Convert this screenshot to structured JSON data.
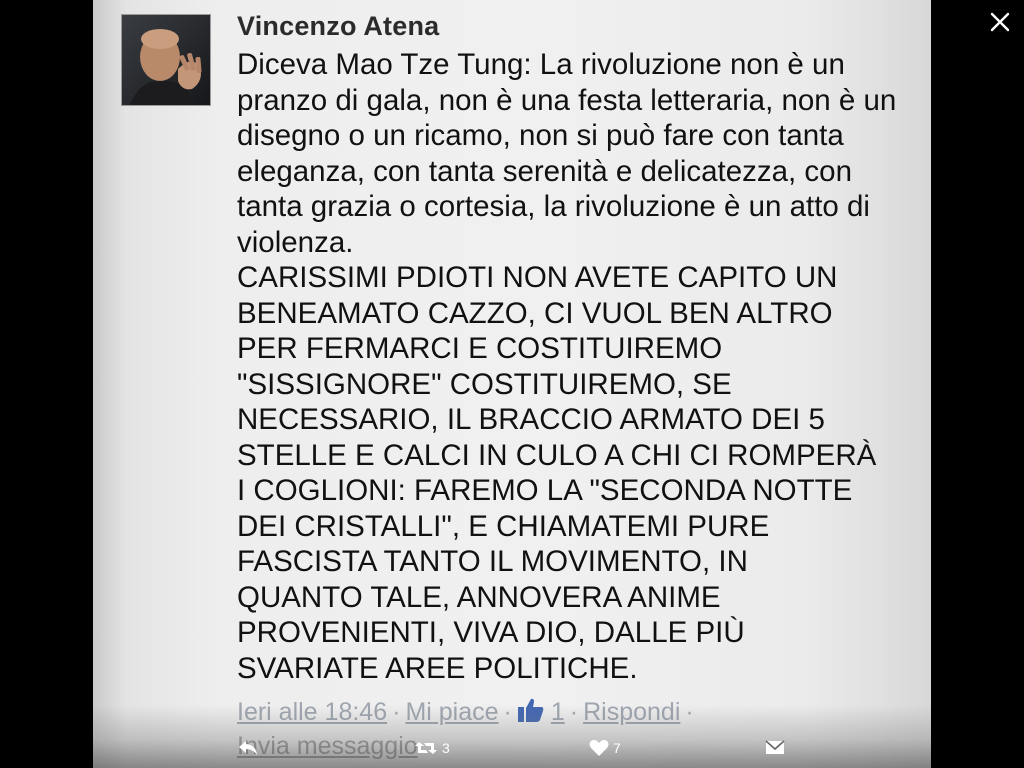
{
  "post": {
    "author": "Vincenzo Atena",
    "quote": "Diceva Mao Tze Tung: La rivoluzione non è un pranzo di gala, non è una festa letteraria, non è un disegno o un ricamo, non si può fare con tanta eleganza, con tanta serenità e delicatezza, con tanta grazia o cortesia, la rivoluzione è un atto di violenza.",
    "caps_lines": [
      "CARISSIMI PDIOTI NON AVETE CAPITO UN",
      "BENEAMATO CAZZO, CI VUOL BEN ALTRO",
      "PER FERMARCI E COSTITUIREMO",
      "\"SISSIGNORE\" COSTITUIREMO, SE",
      "NECESSARIO, IL BRACCIO ARMATO DEI 5",
      "STELLE E CALCI IN CULO A CHI CI ROMPERÀ",
      "I COGLIONI: FAREMO LA \"SECONDA NOTTE",
      "DEI CRISTALLI\", E CHIAMATEMI PURE",
      "FASCISTA TANTO IL MOVIMENTO,  IN",
      "QUANTO TALE, ANNOVERA ANIME",
      "PROVENIENTI,  VIVA DIO, DALLE PIÙ",
      "SVARIATE AREE POLITICHE."
    ],
    "timestamp": "Ieri alle 18:46",
    "like_label": "Mi piace",
    "like_count": "1",
    "reply_label": "Rispondi",
    "message_label": "Invia messaggio",
    "separator": "·"
  },
  "tweet_actions": {
    "retweet_count": "3",
    "like_count": "7"
  },
  "colors": {
    "page_bg": "#000000",
    "photo_bg": "#eeeeee",
    "text": "#111111",
    "meta": "#9a9a9a",
    "thumb": "#4267b2"
  },
  "icons": [
    "close-icon",
    "reply-icon",
    "retweet-icon",
    "heart-icon",
    "direct-message-icon",
    "like-thumb-icon"
  ]
}
